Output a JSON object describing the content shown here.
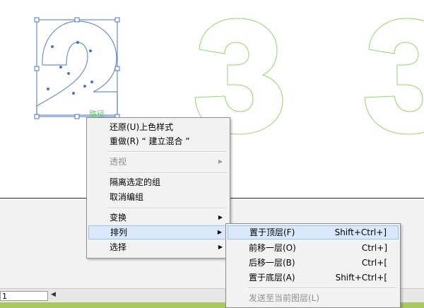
{
  "canvas": {
    "path_label": "路径",
    "glyphs": [
      "2",
      "3",
      "3"
    ]
  },
  "context_menu": {
    "items": [
      {
        "label": "还原(U)上色样式",
        "disabled": false,
        "submenu": false
      },
      {
        "label": "重做(R) “ 建立混合 ”",
        "disabled": false,
        "submenu": false
      },
      {
        "label": "透视",
        "disabled": true,
        "submenu": true
      },
      {
        "label": "隔离选定的组",
        "disabled": false,
        "submenu": false
      },
      {
        "label": "取消编组",
        "disabled": false,
        "submenu": false
      },
      {
        "label": "变换",
        "disabled": false,
        "submenu": true
      },
      {
        "label": "排列",
        "disabled": false,
        "submenu": true,
        "highlighted": true
      },
      {
        "label": "选择",
        "disabled": false,
        "submenu": true
      }
    ]
  },
  "arrange_submenu": {
    "items": [
      {
        "label": "置于顶层(F)",
        "shortcut": "Shift+Ctrl+]",
        "highlighted": true
      },
      {
        "label": "前移一层(O)",
        "shortcut": "Ctrl+]"
      },
      {
        "label": "后移一层(B)",
        "shortcut": "Ctrl+["
      },
      {
        "label": "置于底层(A)",
        "shortcut": "Shift+Ctrl+["
      },
      {
        "label": "发送至当前图层(L)",
        "shortcut": "",
        "disabled": true
      }
    ]
  },
  "status_bar": {
    "page_value": "1"
  },
  "colors": {
    "glyph_outline": "#8fd86a",
    "selection": "#4a74c9",
    "menu_highlight": "#d9e8fb"
  },
  "icons": {
    "submenu_arrow": "triangle-right-icon",
    "page_prev": "triangle-left-icon"
  }
}
